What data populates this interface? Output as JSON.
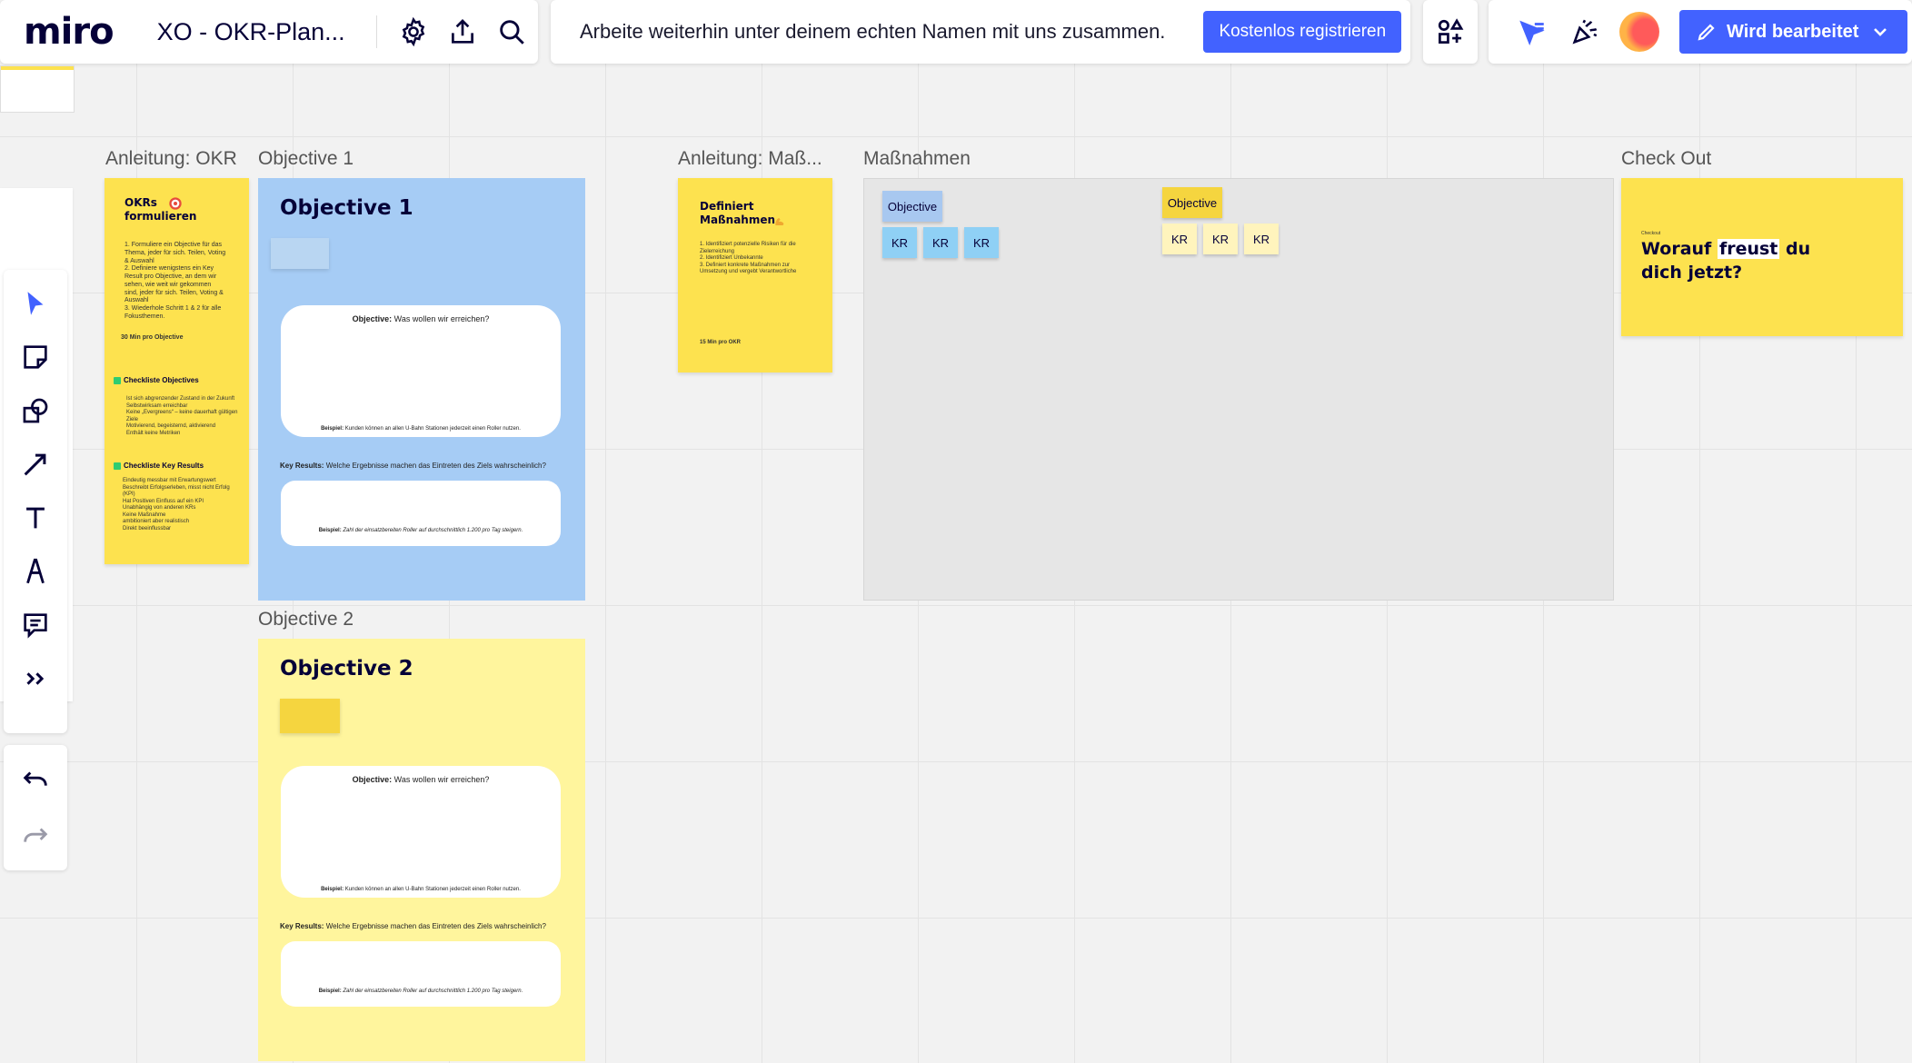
{
  "app": {
    "logo": "miro",
    "board_title": "XO - OKR-Plan...",
    "icons": [
      "gear-icon",
      "share-icon",
      "search-icon"
    ]
  },
  "banner": {
    "text": "Arbeite weiterhin unter deinem echten Namen mit uns zusammen.",
    "register_label": "Kostenlos registrieren"
  },
  "collab": {
    "edit_label": "Wird bearbeitet",
    "icons": [
      "apps-icon",
      "cursor-flag-icon",
      "celebrate-icon",
      "avatar",
      "pencil-icon",
      "chevron-down-icon"
    ]
  },
  "toolbar": {
    "tools": [
      "select-icon",
      "sticky-note-icon",
      "shapes-icon",
      "line-icon",
      "text-icon",
      "pen-icon",
      "comment-icon",
      "more-icon"
    ],
    "history": [
      "undo-icon",
      "redo-icon"
    ]
  },
  "frames": {
    "anleitung_okr": {
      "label": "Anleitung: OKR",
      "heading": "OKRs formulieren",
      "steps": [
        "1. Formuliere ein Objective für das Thema, jeder für sich. Teilen, Voting & Auswahl",
        "2. Definiere wenigstens ein Key Result pro Objective, an dem wir sehen, wie weit wir gekommen sind, jeder für sich. Teilen, Voting & Auswahl",
        "3. Wiederhole Schritt 1 & 2 für alle Fokusthemen."
      ],
      "time": "30 Min pro Objective",
      "checklist_objectives_title": "Checkliste Objectives",
      "checklist_objectives": [
        "Ist sich abgrenzender Zustand in der Zukunft",
        "Selbstwirksam erreichbar",
        "Keine „Evergreens“ – keine dauerhaft gültigen Ziele",
        "Motivierend, begeisternd, aktivierend",
        "Enthält keine Metriken"
      ],
      "checklist_kr_title": "Checkliste Key Results",
      "checklist_kr": [
        "Eindeutig messbar mit Erwartungswert",
        "Beschreibt Erfolgserleben, misst nicht Erfolg (KPI)",
        "Hat Positiven Einfluss auf ein KPI",
        "Unabhängig von anderen KRs",
        "Keine Maßnahme",
        "ambitioniert aber realistisch",
        "Direkt beeinflussbar"
      ]
    },
    "objective1": {
      "label": "Objective 1",
      "title": "Objective 1",
      "objective_q_bold": "Objective:",
      "objective_q": "Was wollen wir erreichen?",
      "objective_example_bold": "Beispiel:",
      "objective_example": "Kunden können an allen U-Bahn Stationen jederzeit einen Roller nutzen.",
      "kr_q_bold": "Key Results:",
      "kr_q": "Welche Ergebnisse machen das Eintreten des Ziels wahrscheinlich?",
      "kr_example_bold": "Beispiel:",
      "kr_example": "Zahl der einsatzbereiten Roller auf durchschnittlich 1.200 pro Tag steigern."
    },
    "objective2": {
      "label": "Objective 2",
      "title": "Objective 2",
      "objective_q_bold": "Objective:",
      "objective_q": "Was wollen wir erreichen?",
      "objective_example_bold": "Beispiel:",
      "objective_example": "Kunden können an allen U-Bahn Stationen jederzeit einen Roller nutzen.",
      "kr_q_bold": "Key Results:",
      "kr_q": "Welche Ergebnisse machen das Eintreten des Ziels wahrscheinlich?",
      "kr_example_bold": "Beispiel:",
      "kr_example": "Zahl der einsatzbereiten Roller auf durchschnittlich 1.200 pro Tag steigern."
    },
    "anleitung_massnahmen": {
      "label": "Anleitung: Maß...",
      "heading": "Definiert Maßnahmen",
      "steps": [
        "1. Identifiziert potenzielle Risiken für die Zielerreichung",
        "2. Identifiziert Unbekannte",
        "3. Definiert konkrete Maßnahmen zur Umsetzung und vergebt Verantwortliche"
      ],
      "time": "15 Min pro OKR"
    },
    "massnahmen": {
      "label": "Maßnahmen",
      "group1_objective": "Objective",
      "group1_krs": [
        "KR",
        "KR",
        "KR"
      ],
      "group2_objective": "Objective",
      "group2_krs": [
        "KR",
        "KR",
        "KR"
      ]
    },
    "checkout": {
      "label": "Check Out",
      "kicker": "Checkout",
      "question_pre": "Worauf ",
      "question_highlight": "freust",
      "question_post": " du dich jetzt?"
    }
  },
  "colors": {
    "accent": "#4262ff",
    "sticky_yellow": "#fde24f",
    "frame_blue": "#a6ccf5",
    "frame_yellow": "#fff59d",
    "kr_blue": "#8fd0f5",
    "kr_cream": "#fff4bd",
    "massnahmen_bg": "#e6e6e6"
  }
}
